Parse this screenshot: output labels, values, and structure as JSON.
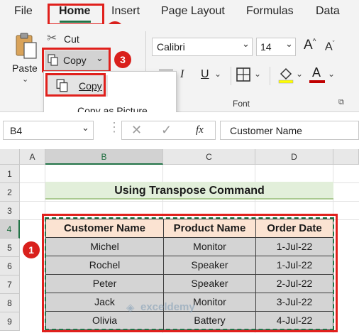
{
  "menu": {
    "file": "File",
    "home": "Home",
    "insert": "Insert",
    "page_layout": "Page Layout",
    "formulas": "Formulas",
    "data": "Data"
  },
  "clipboard": {
    "paste_label": "Paste",
    "cut_label": "Cut",
    "copy_label": "Copy"
  },
  "copy_menu": {
    "items": [
      "Copy",
      "Copy as Picture..."
    ]
  },
  "font": {
    "family": "Calibri",
    "size": "14",
    "group_label": "Font"
  },
  "formula_bar": {
    "name_box": "B4",
    "fx": "fx",
    "content": "Customer Name"
  },
  "grid": {
    "columns": [
      "A",
      "B",
      "C",
      "D"
    ],
    "rows": [
      "1",
      "2",
      "3",
      "4",
      "5",
      "6",
      "7",
      "8",
      "9"
    ]
  },
  "sheet": {
    "title": "Using Transpose Command",
    "headers": [
      "Customer Name",
      "Product Name",
      "Order Date"
    ],
    "rows": [
      [
        "Michel",
        "Monitor",
        "1-Jul-22"
      ],
      [
        "Rochel",
        "Speaker",
        "1-Jul-22"
      ],
      [
        "Peter",
        "Speaker",
        "2-Jul-22"
      ],
      [
        "Jack",
        "Monitor",
        "3-Jul-22"
      ],
      [
        "Olivia",
        "Battery",
        "4-Jul-22"
      ]
    ]
  },
  "badges": [
    "1",
    "2",
    "3"
  ],
  "watermark": "exceldemy",
  "colors": {
    "accent_green": "#217346",
    "callout_red": "#e0201c",
    "header_fill": "#fbe3d2",
    "data_fill": "#d4d4d4",
    "title_fill": "#e2efda"
  }
}
